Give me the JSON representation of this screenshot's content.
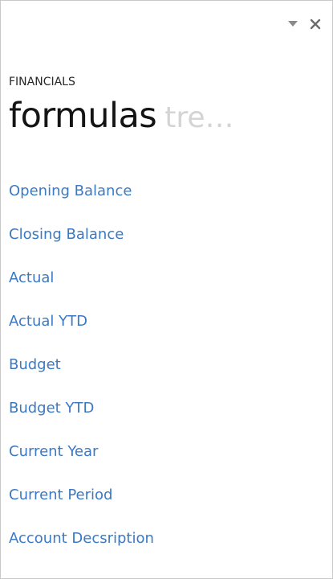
{
  "pane": {
    "eyebrow": "FINANCIALS",
    "pivot": {
      "active": "formulas",
      "inactive": "tre…"
    },
    "controls": {
      "menu_icon": "chevron-down-icon",
      "close_icon": "close-icon"
    }
  },
  "formulas": [
    {
      "label": "Opening Balance"
    },
    {
      "label": "Closing Balance"
    },
    {
      "label": "Actual"
    },
    {
      "label": "Actual YTD"
    },
    {
      "label": "Budget"
    },
    {
      "label": "Budget YTD"
    },
    {
      "label": "Current Year"
    },
    {
      "label": "Current Period"
    },
    {
      "label": "Account Decsription"
    }
  ],
  "colors": {
    "link": "#3b79c4",
    "heading": "#141414",
    "inactive_pivot": "#d4d4d4",
    "border": "#c9c9c9",
    "icon": "#6b6b6b"
  }
}
